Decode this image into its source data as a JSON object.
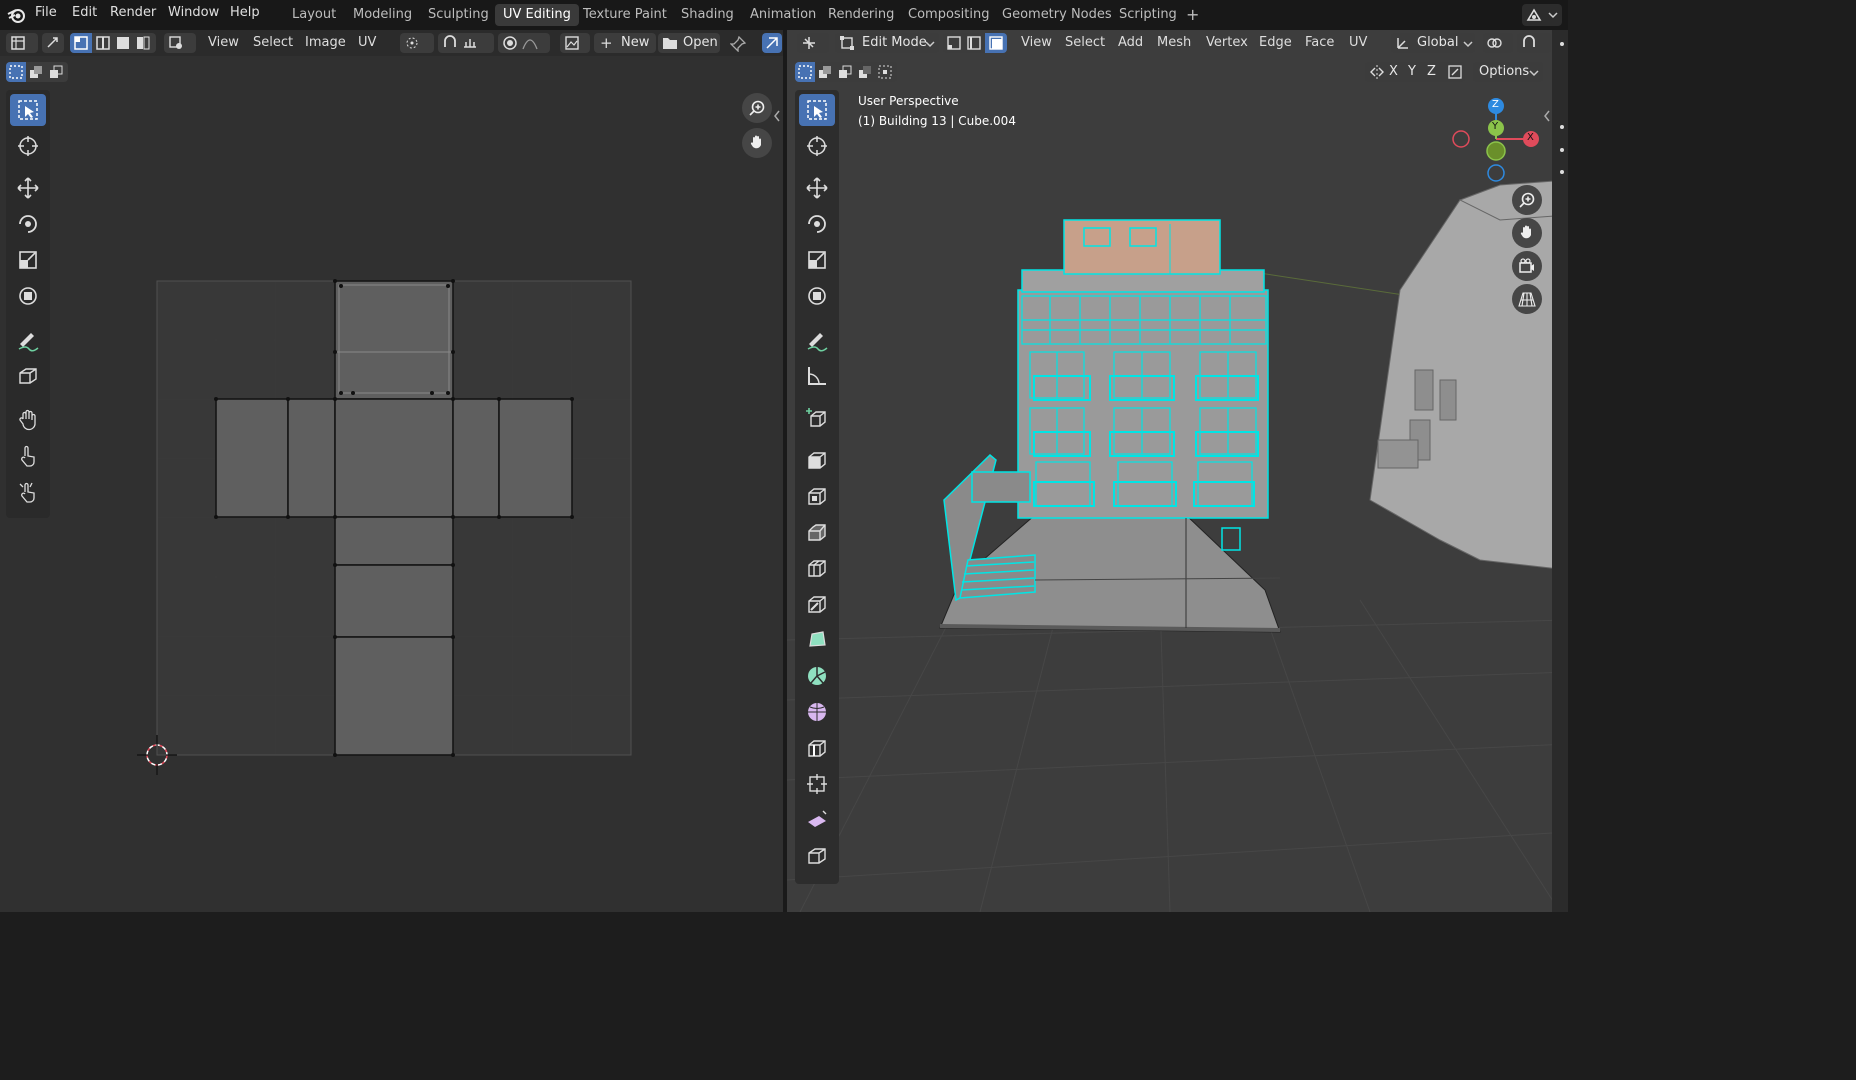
{
  "topbar": {
    "menus": [
      "File",
      "Edit",
      "Render",
      "Window",
      "Help"
    ],
    "workspaces": [
      "Layout",
      "Modeling",
      "Sculpting",
      "UV Editing",
      "Texture Paint",
      "Shading",
      "Animation",
      "Rendering",
      "Compositing",
      "Geometry Nodes",
      "Scripting"
    ],
    "active_workspace": "UV Editing",
    "add_tab": "+"
  },
  "uv_editor": {
    "menus": [
      "View",
      "Select",
      "Image",
      "UV"
    ],
    "new_label": "New",
    "open_label": "Open"
  },
  "viewport": {
    "mode_label": "Edit Mode",
    "menus": [
      "View",
      "Select",
      "Add",
      "Mesh",
      "Vertex",
      "Edge",
      "Face",
      "UV"
    ],
    "orientation_label": "Global",
    "axes": [
      "X",
      "Y",
      "Z"
    ],
    "options_label": "Options",
    "overlay_line1": "User Perspective",
    "overlay_line2": "(1) Building 13 | Cube.004",
    "gizmo": {
      "z": "Z",
      "y": "Y",
      "x": "X"
    }
  },
  "colors": {
    "accent": "#4772b3",
    "selection": "#00e5e5",
    "axis_x": "#e04b5b",
    "axis_y": "#8bc34a",
    "axis_z": "#2e8ae0"
  }
}
